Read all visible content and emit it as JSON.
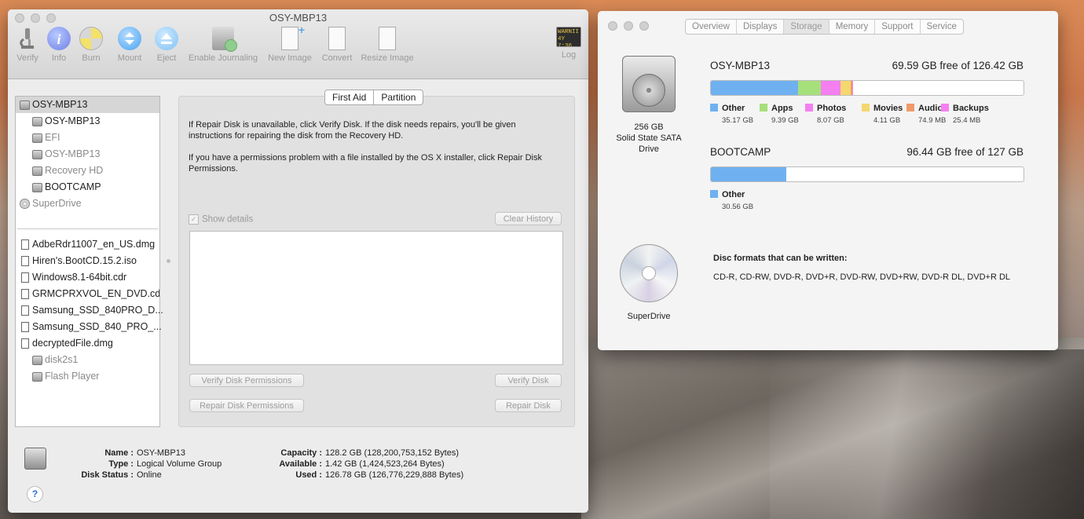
{
  "disk_utility": {
    "title": "OSY-MBP13",
    "toolbar": [
      {
        "label": "Verify",
        "icon": "microscope-icon"
      },
      {
        "label": "Info",
        "icon": "info-icon"
      },
      {
        "label": "Burn",
        "icon": "burn-icon"
      },
      {
        "label": "Mount",
        "icon": "mount-icon"
      },
      {
        "label": "Eject",
        "icon": "eject-icon"
      },
      {
        "label": "Enable Journaling",
        "icon": "journaling-icon"
      },
      {
        "label": "New Image",
        "icon": "new-image-icon"
      },
      {
        "label": "Convert",
        "icon": "convert-icon"
      },
      {
        "label": "Resize Image",
        "icon": "resize-image-icon"
      },
      {
        "label": "Log",
        "icon": "log-icon",
        "log_text_1": "WARNII",
        "log_text_2": "4Y 7:36"
      }
    ],
    "sidebar": {
      "items": [
        {
          "label": "OSY-MBP13",
          "kind": "disk"
        },
        {
          "label": "OSY-MBP13",
          "kind": "disk"
        },
        {
          "label": "EFI",
          "kind": "disk"
        },
        {
          "label": "OSY-MBP13",
          "kind": "disk"
        },
        {
          "label": "Recovery HD",
          "kind": "disk"
        },
        {
          "label": "BOOTCAMP",
          "kind": "disk"
        },
        {
          "label": "SuperDrive",
          "kind": "cd"
        }
      ],
      "images": [
        {
          "label": "AdbeRdr11007_en_US.dmg",
          "kind": "file"
        },
        {
          "label": "Hiren's.BootCD.15.2.iso",
          "kind": "file"
        },
        {
          "label": "Windows8.1-64bit.cdr",
          "kind": "file"
        },
        {
          "label": "GRMCPRXVOL_EN_DVD.cdr",
          "kind": "file"
        },
        {
          "label": "Samsung_SSD_840PRO_D...",
          "kind": "file"
        },
        {
          "label": "Samsung_SSD_840_PRO_...",
          "kind": "file"
        },
        {
          "label": "decryptedFile.dmg",
          "kind": "file"
        },
        {
          "label": "disk2s1",
          "kind": "disk"
        },
        {
          "label": "Flash Player",
          "kind": "disk"
        }
      ]
    },
    "tabs": {
      "first_aid": "First Aid",
      "partition": "Partition"
    },
    "first_aid": {
      "text1": "If Repair Disk is unavailable, click Verify Disk. If the disk needs repairs, you'll be given instructions for repairing the disk from the Recovery HD.",
      "text2": "If you have a permissions problem with a file installed by the OS X installer, click Repair Disk Permissions.",
      "show_details": "Show details",
      "clear_history": "Clear History",
      "verify_permissions": "Verify Disk Permissions",
      "verify_disk": "Verify Disk",
      "repair_permissions": "Repair Disk Permissions",
      "repair_disk": "Repair Disk"
    },
    "info": {
      "name_label": "Name :",
      "name": "OSY-MBP13",
      "type_label": "Type :",
      "type": "Logical Volume Group",
      "status_label": "Disk Status :",
      "status": "Online",
      "capacity_label": "Capacity :",
      "capacity": "128.2 GB (128,200,753,152 Bytes)",
      "available_label": "Available :",
      "available": "1.42 GB (1,424,523,264 Bytes)",
      "used_label": "Used :",
      "used": "126.78 GB (126,776,229,888 Bytes)"
    },
    "help": "?"
  },
  "system_info": {
    "tabs": [
      "Overview",
      "Displays",
      "Storage",
      "Memory",
      "Support",
      "Service"
    ],
    "drive_caption_1": "256 GB",
    "drive_caption_2": "Solid State SATA",
    "drive_caption_3": "Drive",
    "volumes": [
      {
        "name": "OSY-MBP13",
        "free": "69.59 GB free of 126.42 GB",
        "segments": [
          {
            "label": "Other",
            "size": "35.17 GB",
            "fraction": 0.278,
            "color": "#6fb1f0"
          },
          {
            "label": "Apps",
            "size": "9.39 GB",
            "fraction": 0.074,
            "color": "#a6e07a"
          },
          {
            "label": "Photos",
            "size": "8.07 GB",
            "fraction": 0.064,
            "color": "#f47ff0"
          },
          {
            "label": "Movies",
            "size": "4.11 GB",
            "fraction": 0.033,
            "color": "#f5d76e"
          },
          {
            "label": "Audio",
            "size": "74.9 MB",
            "fraction": 0.006,
            "color": "#f09a6a"
          },
          {
            "label": "Backups",
            "size": "25.4 MB",
            "fraction": 0.002,
            "color": "#f47ff0"
          }
        ]
      },
      {
        "name": "BOOTCAMP",
        "free": "96.44 GB free of 127 GB",
        "segments": [
          {
            "label": "Other",
            "size": "30.56 GB",
            "fraction": 0.241,
            "color": "#6fb1f0"
          }
        ]
      }
    ],
    "superdrive_label": "SuperDrive",
    "disc_formats_title": "Disc formats that can be written:",
    "disc_formats": "CD-R, CD-RW, DVD-R, DVD+R, DVD-RW, DVD+RW, DVD-R DL, DVD+R DL"
  }
}
